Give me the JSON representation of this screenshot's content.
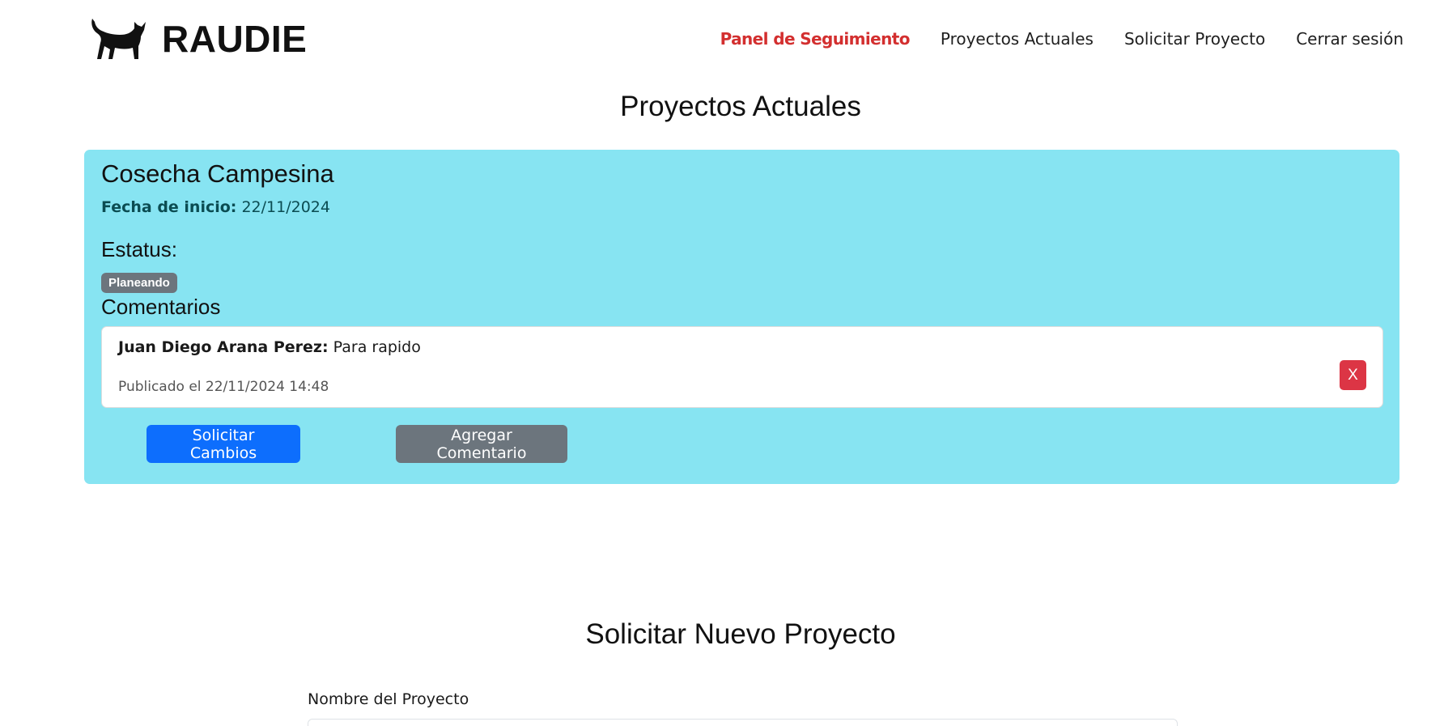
{
  "brand": {
    "name": "RAUDIE",
    "logo_icon": "cat-icon"
  },
  "nav": {
    "items": [
      {
        "label": "Panel de Seguimiento",
        "active": true
      },
      {
        "label": "Proyectos Actuales",
        "active": false
      },
      {
        "label": "Solicitar Proyecto",
        "active": false
      },
      {
        "label": "Cerrar sesión",
        "active": false
      }
    ]
  },
  "projects_section": {
    "title": "Proyectos Actuales"
  },
  "project": {
    "name": "Cosecha Campesina",
    "start_label": "Fecha de inicio:",
    "start_date": "22/11/2024",
    "status_label": "Estatus:",
    "status": "Planeando",
    "comments_label": "Comentarios",
    "comments": [
      {
        "author": "Juan Diego Arana Perez:",
        "text": "Para rapido",
        "published": "Publicado el 22/11/2024 14:48",
        "delete_label": "X"
      }
    ],
    "request_changes_label": "Solicitar Cambios",
    "add_comment_label": "Agregar Comentario"
  },
  "new_project": {
    "title": "Solicitar Nuevo Proyecto",
    "name_label": "Nombre del Proyecto",
    "name_value": ""
  },
  "colors": {
    "card_bg": "#87e4f2",
    "active_nav": "#d32f2f",
    "primary": "#0d6efd",
    "secondary": "#6c757d",
    "danger": "#dc3545"
  }
}
